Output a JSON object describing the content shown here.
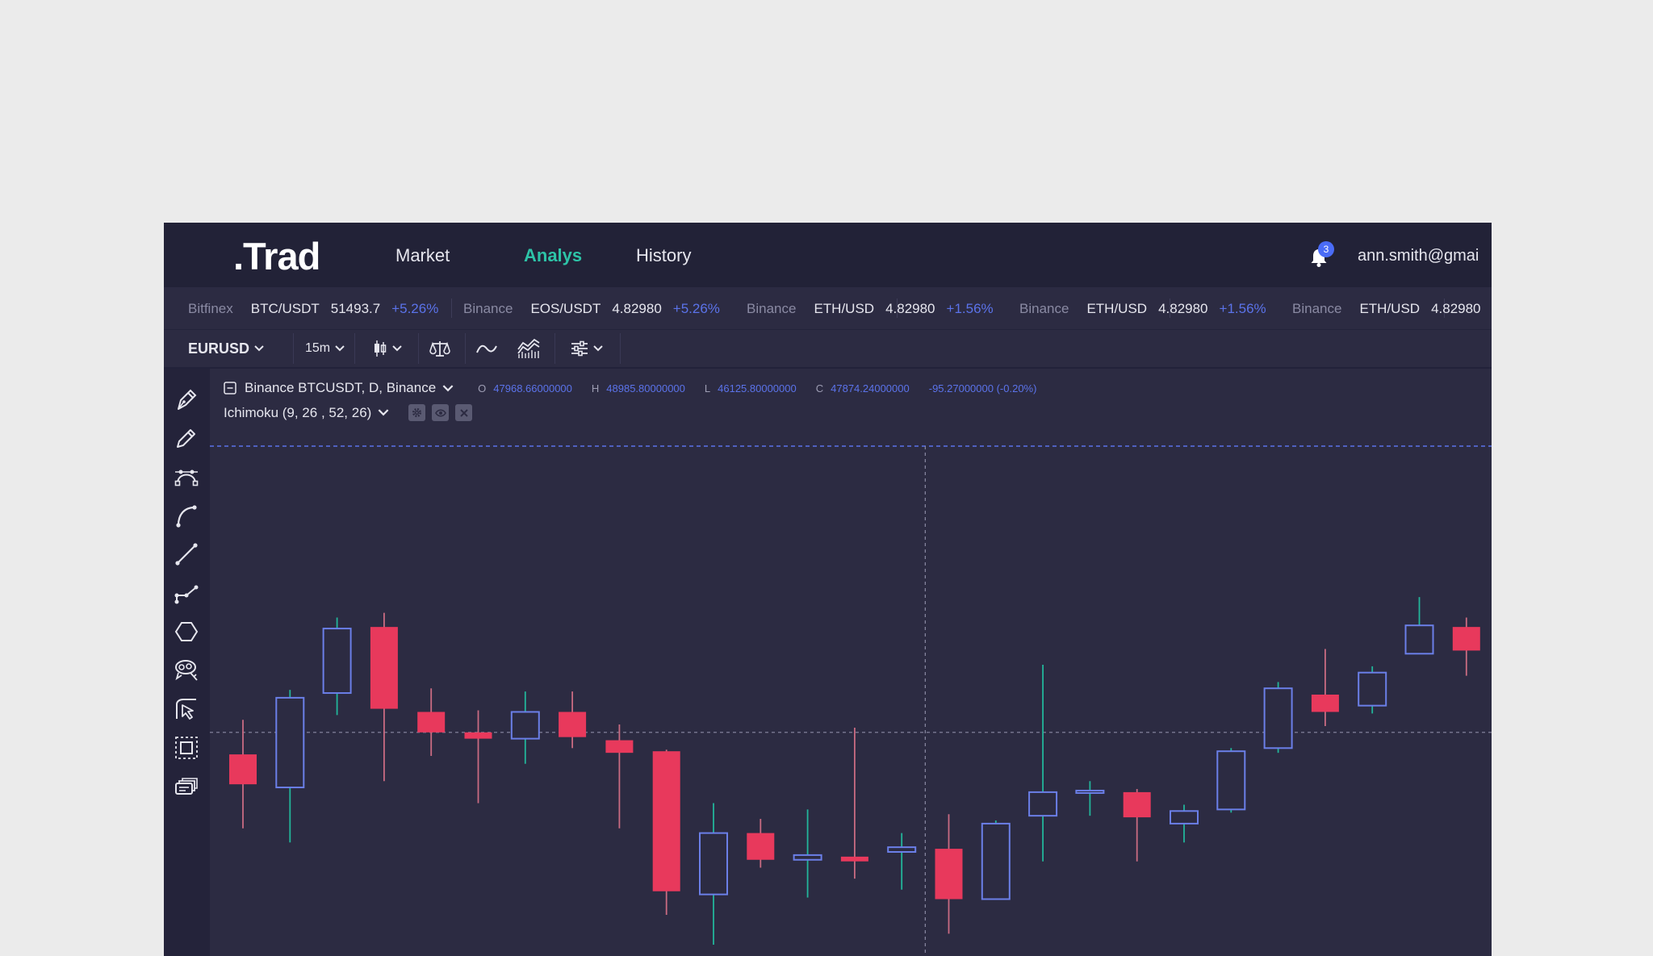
{
  "app": {
    "logo": ".Trad"
  },
  "nav": {
    "items": [
      {
        "label": "Market",
        "active": false
      },
      {
        "label": "Analys",
        "active": true
      },
      {
        "label": "History",
        "active": false
      }
    ],
    "notification_count": "3",
    "user_email": "ann.smith@gmai"
  },
  "ticker": [
    {
      "exchange": "Bitfinex",
      "pair": "BTC/USDT",
      "price": "51493.7",
      "change": "+5.26%"
    },
    {
      "exchange": "Binance",
      "pair": "EOS/USDT",
      "price": "4.82980",
      "change": "+5.26%"
    },
    {
      "exchange": "Binance",
      "pair": "ETH/USD",
      "price": "4.82980",
      "change": "+1.56%"
    },
    {
      "exchange": "Binance",
      "pair": "ETH/USD",
      "price": "4.82980",
      "change": "+1.56%"
    },
    {
      "exchange": "Binance",
      "pair": "ETH/USD",
      "price": "4.82980",
      "change": ""
    }
  ],
  "toolbar": {
    "symbol": "EURUSD",
    "interval": "15m",
    "icons": [
      "candles-icon",
      "compare-icon",
      "line-indicator-icon",
      "indicators-icon",
      "settings-sliders-icon"
    ]
  },
  "sidebar": {
    "tools": [
      "pen-icon",
      "pencil-icon",
      "bezier-icon",
      "arc-icon",
      "trend-line-icon",
      "polyline-icon",
      "hexagon-icon",
      "brush-selection-icon",
      "cursor-arrow-icon",
      "select-area-icon",
      "layers-icon"
    ]
  },
  "legend": {
    "symbol": "Binance BTCUSDT, D, Binance",
    "open_label": "O",
    "open": "47968.66000000",
    "high_label": "H",
    "high": "48985.80000000",
    "low_label": "L",
    "low": "46125.80000000",
    "close_label": "C",
    "close": "47874.24000000",
    "change": "-95.27000000 (-0.20%)",
    "indicator": "Ichimoku (9, 26 , 52, 26)"
  },
  "colors": {
    "up_outline": "#6b7fe8",
    "down_fill": "#e8395c",
    "up_wick": "#22b59a",
    "down_wick": "#c96b82",
    "accent_green": "#2dc3a7",
    "accent_blue": "#5b73ea",
    "chart_bg": "#2c2b42"
  },
  "chart_data": {
    "type": "candlestick",
    "price_axis_note": "no axis labels visible",
    "candles": [
      {
        "o": 51.0,
        "h": 62.0,
        "l": 27.5,
        "c": 41.5
      },
      {
        "o": 40.5,
        "h": 71.5,
        "l": 23.0,
        "c": 69.0
      },
      {
        "o": 70.5,
        "h": 94.5,
        "l": 63.5,
        "c": 91.0
      },
      {
        "o": 91.5,
        "h": 96.0,
        "l": 42.5,
        "c": 65.5
      },
      {
        "o": 64.5,
        "h": 72.0,
        "l": 50.5,
        "c": 58.0
      },
      {
        "o": 58.0,
        "h": 65.0,
        "l": 35.5,
        "c": 56.0
      },
      {
        "o": 56.0,
        "h": 71.0,
        "l": 48.0,
        "c": 64.5
      },
      {
        "o": 64.5,
        "h": 71.0,
        "l": 53.0,
        "c": 56.5
      },
      {
        "o": 55.5,
        "h": 60.5,
        "l": 27.5,
        "c": 51.5
      },
      {
        "o": 52.0,
        "h": 52.5,
        "l": 0.0,
        "c": 7.5
      },
      {
        "o": 6.5,
        "h": 35.5,
        "l": -9.5,
        "c": 26.0
      },
      {
        "o": 26.0,
        "h": 30.5,
        "l": 15.0,
        "c": 17.5
      },
      {
        "o": 17.5,
        "h": 33.5,
        "l": 5.5,
        "c": 19.0
      },
      {
        "o": 18.5,
        "h": 59.5,
        "l": 11.5,
        "c": 17.0
      },
      {
        "o": 20.0,
        "h": 26.0,
        "l": 8.0,
        "c": 21.5
      },
      {
        "o": 21.0,
        "h": 32.0,
        "l": -6.0,
        "c": 5.0
      },
      {
        "o": 5.0,
        "h": 30.0,
        "l": 5.0,
        "c": 29.0
      },
      {
        "o": 31.5,
        "h": 79.5,
        "l": 17.0,
        "c": 39.0
      },
      {
        "o": 39.0,
        "h": 42.5,
        "l": 31.5,
        "c": 39.5
      },
      {
        "o": 39.0,
        "h": 40.0,
        "l": 17.0,
        "c": 31.0
      },
      {
        "o": 29.0,
        "h": 35.0,
        "l": 23.0,
        "c": 33.0
      },
      {
        "o": 33.5,
        "h": 53.0,
        "l": 32.5,
        "c": 52.0
      },
      {
        "o": 53.0,
        "h": 74.0,
        "l": 51.5,
        "c": 72.0
      },
      {
        "o": 70.0,
        "h": 84.5,
        "l": 60.0,
        "c": 64.5
      },
      {
        "o": 66.5,
        "h": 79.0,
        "l": 64.0,
        "c": 77.0
      },
      {
        "o": 83.0,
        "h": 101.0,
        "l": 83.0,
        "c": 92.0
      },
      {
        "o": 91.5,
        "h": 94.5,
        "l": 76.0,
        "c": 84.0
      }
    ],
    "horizontal_price_line": 58.0,
    "crosshair_candle_index": 14.5
  }
}
